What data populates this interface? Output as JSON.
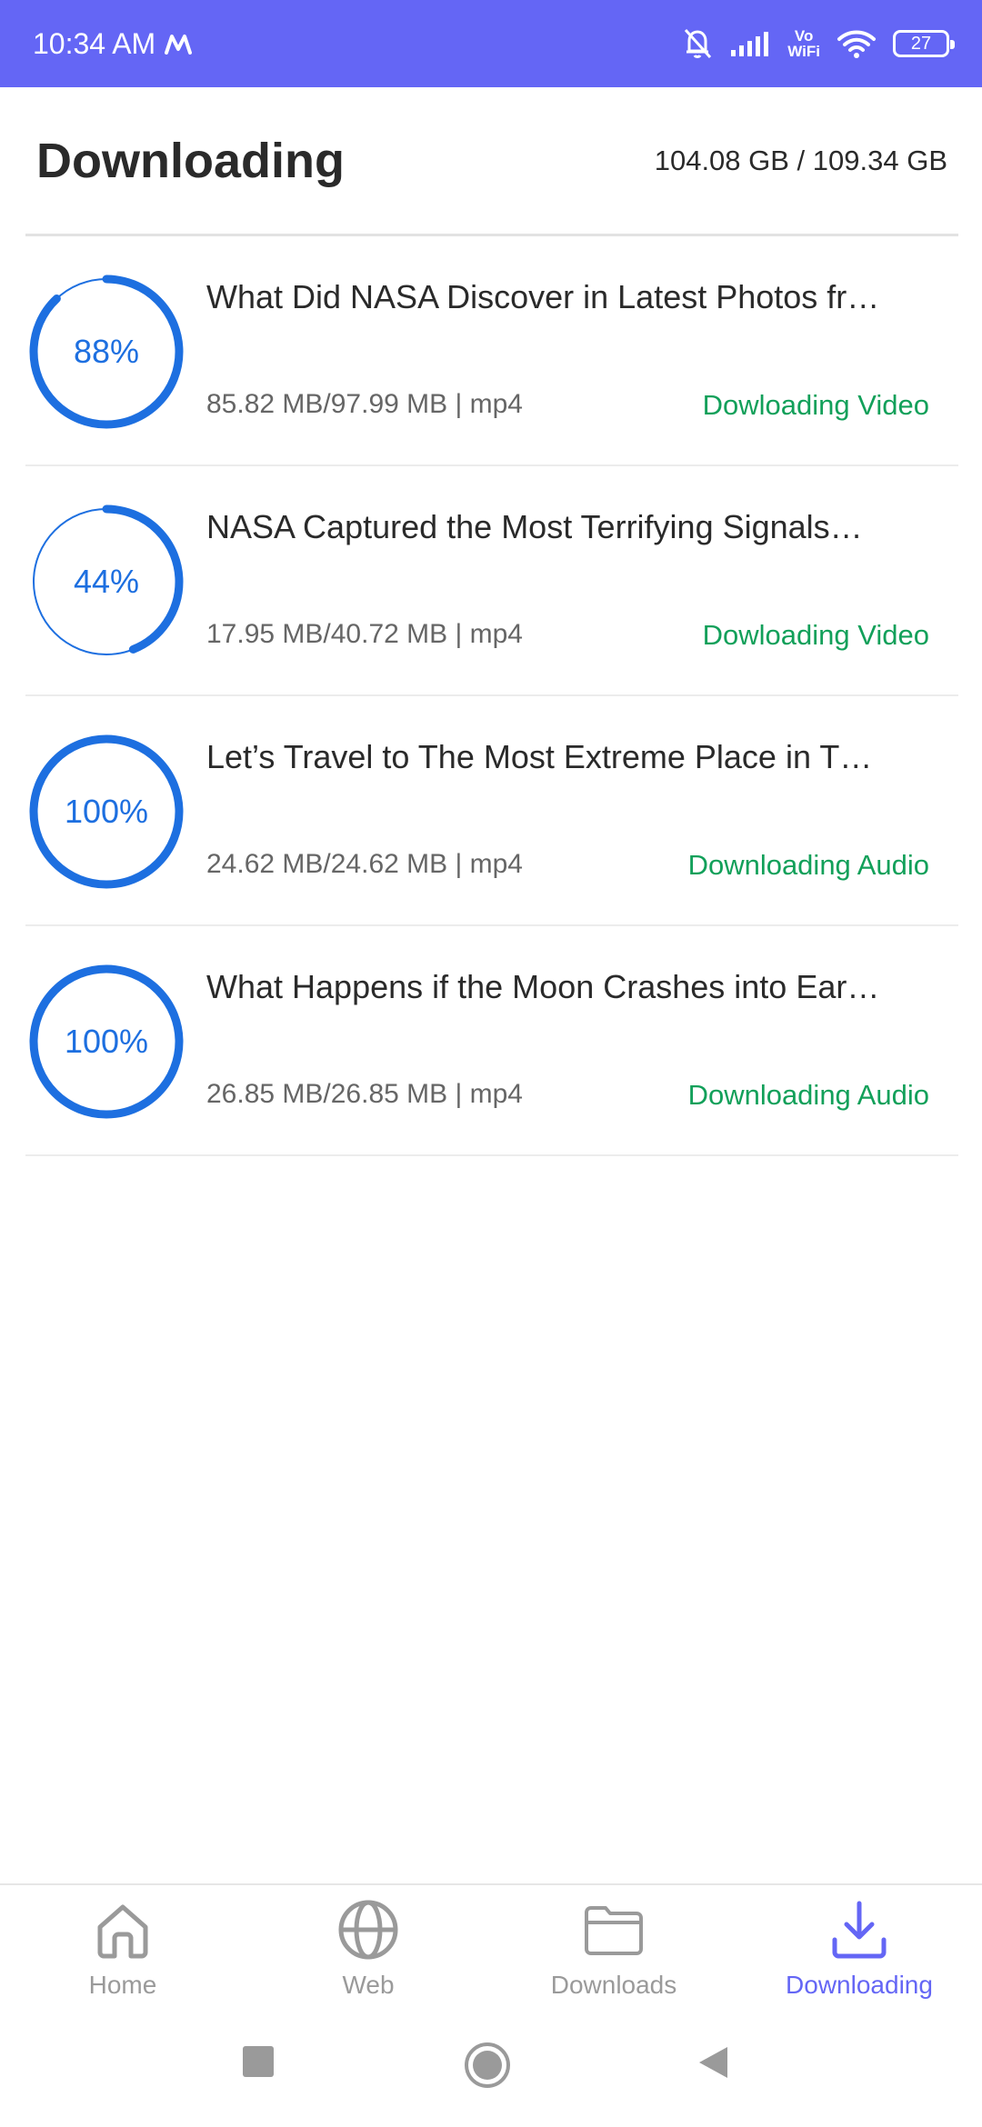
{
  "status_bar": {
    "time": "10:34 AM",
    "vowifi_top": "Vo",
    "vowifi_bottom": "WiFi",
    "battery": "27",
    "icons": [
      "m-app-icon",
      "bell-muted-icon",
      "signal-icon",
      "vowifi-icon",
      "wifi-icon",
      "battery-icon"
    ]
  },
  "header": {
    "title": "Downloading",
    "storage": "104.08 GB / 109.34 GB"
  },
  "downloads": [
    {
      "percent_label": "88%",
      "progress": 0.88,
      "title": "What Did NASA Discover in Latest Photos fr…",
      "meta": "85.82 MB/97.99 MB | mp4",
      "status": "Dowloading Video"
    },
    {
      "percent_label": "44%",
      "progress": 0.44,
      "title": "NASA Captured the Most Terrifying Signals…",
      "meta": "17.95 MB/40.72 MB | mp4",
      "status": "Dowloading Video"
    },
    {
      "percent_label": "100%",
      "progress": 1.0,
      "title": "Let’s Travel to The Most Extreme Place in T…",
      "meta": "24.62 MB/24.62 MB | mp4",
      "status": "Downloading Audio"
    },
    {
      "percent_label": "100%",
      "progress": 1.0,
      "title": "What Happens if the Moon Crashes into Ear…",
      "meta": "26.85 MB/26.85 MB | mp4",
      "status": "Downloading Audio"
    }
  ],
  "bottom_nav": [
    {
      "label": "Home",
      "icon": "home-icon",
      "active": false
    },
    {
      "label": "Web",
      "icon": "globe-icon",
      "active": false
    },
    {
      "label": "Downloads",
      "icon": "folder-icon",
      "active": false
    },
    {
      "label": "Downloading",
      "icon": "download-icon",
      "active": true
    }
  ],
  "colors": {
    "accent": "#6466f5",
    "progress": "#1d6fe0",
    "progress_track": "#1d6fe0",
    "status_green": "#12a05a",
    "nav_inactive": "#9a9a9a"
  },
  "system_nav": [
    "recents-square-icon",
    "home-circle-icon",
    "back-triangle-icon"
  ]
}
